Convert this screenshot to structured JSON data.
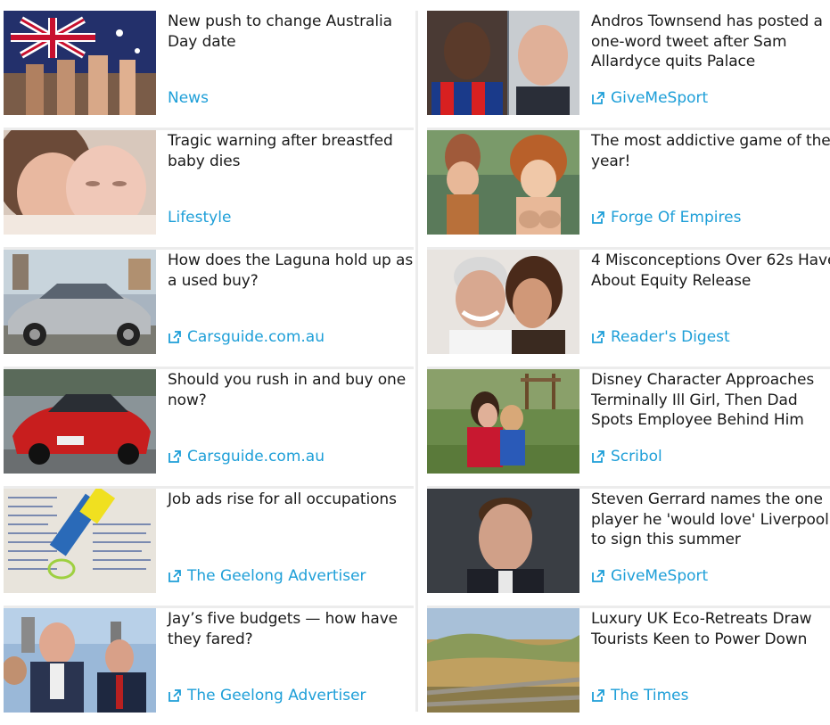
{
  "left_column": [
    {
      "headline": "New push to change Australia Day date",
      "source": "News",
      "external": false,
      "image": "australian-flag-photo"
    },
    {
      "headline": "Tragic warning after breastfed baby dies",
      "source": "Lifestyle",
      "external": false,
      "image": "mother-and-baby-photo"
    },
    {
      "headline": "How does the Laguna hold up as a used buy?",
      "source": "Carsguide.com.au",
      "external": true,
      "image": "silver-car-photo"
    },
    {
      "headline": "Should you rush in and buy one now?",
      "source": "Carsguide.com.au",
      "external": true,
      "image": "red-car-photo"
    },
    {
      "headline": "Job ads rise for all occupations",
      "source": "The Geelong Advertiser",
      "external": true,
      "image": "job-ads-newspaper-photo"
    },
    {
      "headline": "Jay’s five budgets — how have they fared?",
      "source": "The Geelong Advertiser",
      "external": true,
      "image": "politicians-photo"
    }
  ],
  "right_column": [
    {
      "headline": "Andros Townsend has posted a one-word tweet after Sam Allardyce quits Palace",
      "source": "GiveMeSport",
      "external": true,
      "image": "footballers-photo"
    },
    {
      "headline": "The most addictive game of the year!",
      "source": "Forge Of Empires",
      "external": true,
      "image": "game-characters-photo"
    },
    {
      "headline": "4 Misconceptions Over 62s Have About Equity Release",
      "source": "Reader's Digest",
      "external": true,
      "image": "older-couple-photo"
    },
    {
      "headline": "Disney Character Approaches Terminally Ill Girl, Then Dad Spots Employee Behind Him",
      "source": "Scribol",
      "external": true,
      "image": "mother-and-child-photo"
    },
    {
      "headline": "Steven Gerrard names the one player he 'would love' Liverpool to sign this summer",
      "source": "GiveMeSport",
      "external": true,
      "image": "steven-gerrard-photo"
    },
    {
      "headline": "Luxury UK Eco-Retreats Draw Tourists Keen to Power Down",
      "source": "The Times",
      "external": true,
      "image": "countryside-photo"
    }
  ],
  "colors": {
    "source_link": "#1e9fd8",
    "divider": "#ececec",
    "headline": "#1a1a1a"
  },
  "icons": {
    "external_link": "external-link-icon"
  }
}
